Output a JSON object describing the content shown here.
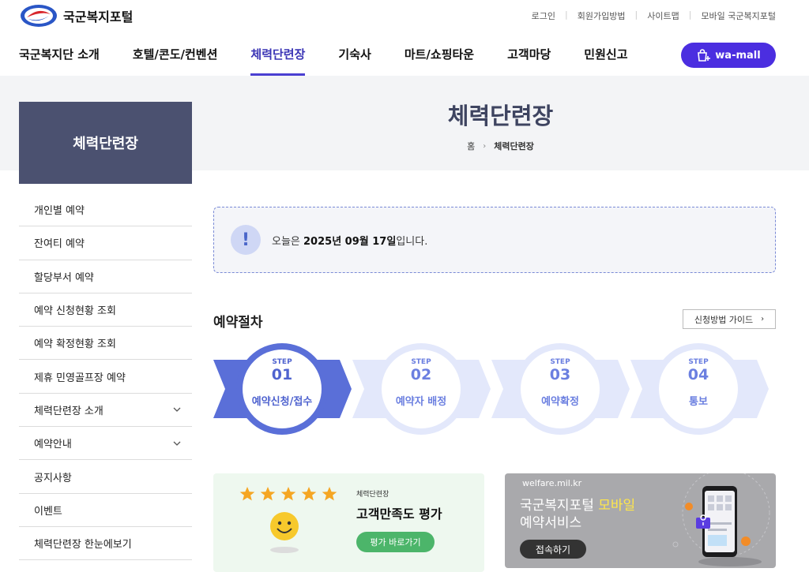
{
  "header": {
    "site_name": "국군복지포털",
    "util_links": [
      "로그인",
      "회원가입방법",
      "사이트맵",
      "모바일 국군복지포털"
    ],
    "gnb": [
      "국군복지단 소개",
      "호텔/콘도/컨벤션",
      "체력단련장",
      "기숙사",
      "마트/쇼핑타운",
      "고객마당",
      "민원신고"
    ],
    "active_gnb": "체력단련장",
    "wamall_label": "wa-mall"
  },
  "sidebar": {
    "title": "체력단련장",
    "items": [
      {
        "label": "개인별 예약",
        "expandable": false
      },
      {
        "label": "잔여티 예약",
        "expandable": false
      },
      {
        "label": "할당부서 예약",
        "expandable": false
      },
      {
        "label": "예약 신청현황 조회",
        "expandable": false
      },
      {
        "label": "예약 확정현황 조회",
        "expandable": false
      },
      {
        "label": "제휴 민영골프장 예약",
        "expandable": false
      },
      {
        "label": "체력단련장 소개",
        "expandable": true
      },
      {
        "label": "예약안내",
        "expandable": true
      },
      {
        "label": "공지사항",
        "expandable": false
      },
      {
        "label": "이벤트",
        "expandable": false
      },
      {
        "label": "체력단련장 한눈에보기",
        "expandable": false
      }
    ]
  },
  "main": {
    "title": "체력단련장",
    "breadcrumb": {
      "home": "홈",
      "current": "체력단련장"
    },
    "notice": {
      "icon": "!",
      "prefix": "오늘은 ",
      "date": "2025년 09월 17일",
      "suffix": "입니다."
    },
    "procedure_title": "예약절차",
    "guide_button": "신청방법 가이드",
    "steps": [
      {
        "small": "STEP",
        "num": "01",
        "label": "예약신청/접수"
      },
      {
        "small": "STEP",
        "num": "02",
        "label": "예약자 배정"
      },
      {
        "small": "STEP",
        "num": "03",
        "label": "예약확정"
      },
      {
        "small": "STEP",
        "num": "04",
        "label": "통보"
      }
    ],
    "survey_card": {
      "small": "체력단련장",
      "title": "고객만족도 평가",
      "button": "평가 바로가기",
      "stars": 5
    },
    "mobile_card": {
      "url": "welfare.mil.kr",
      "title_a": "국군복지포털 ",
      "title_hl": "모바일",
      "title_b": "예약서비스",
      "button": "접속하기"
    }
  },
  "colors": {
    "accent": "#4b2ee0",
    "sidebar_head": "#4b5170",
    "step_active": "#5a6fd8",
    "step_inactive": "#e3e8fb"
  }
}
